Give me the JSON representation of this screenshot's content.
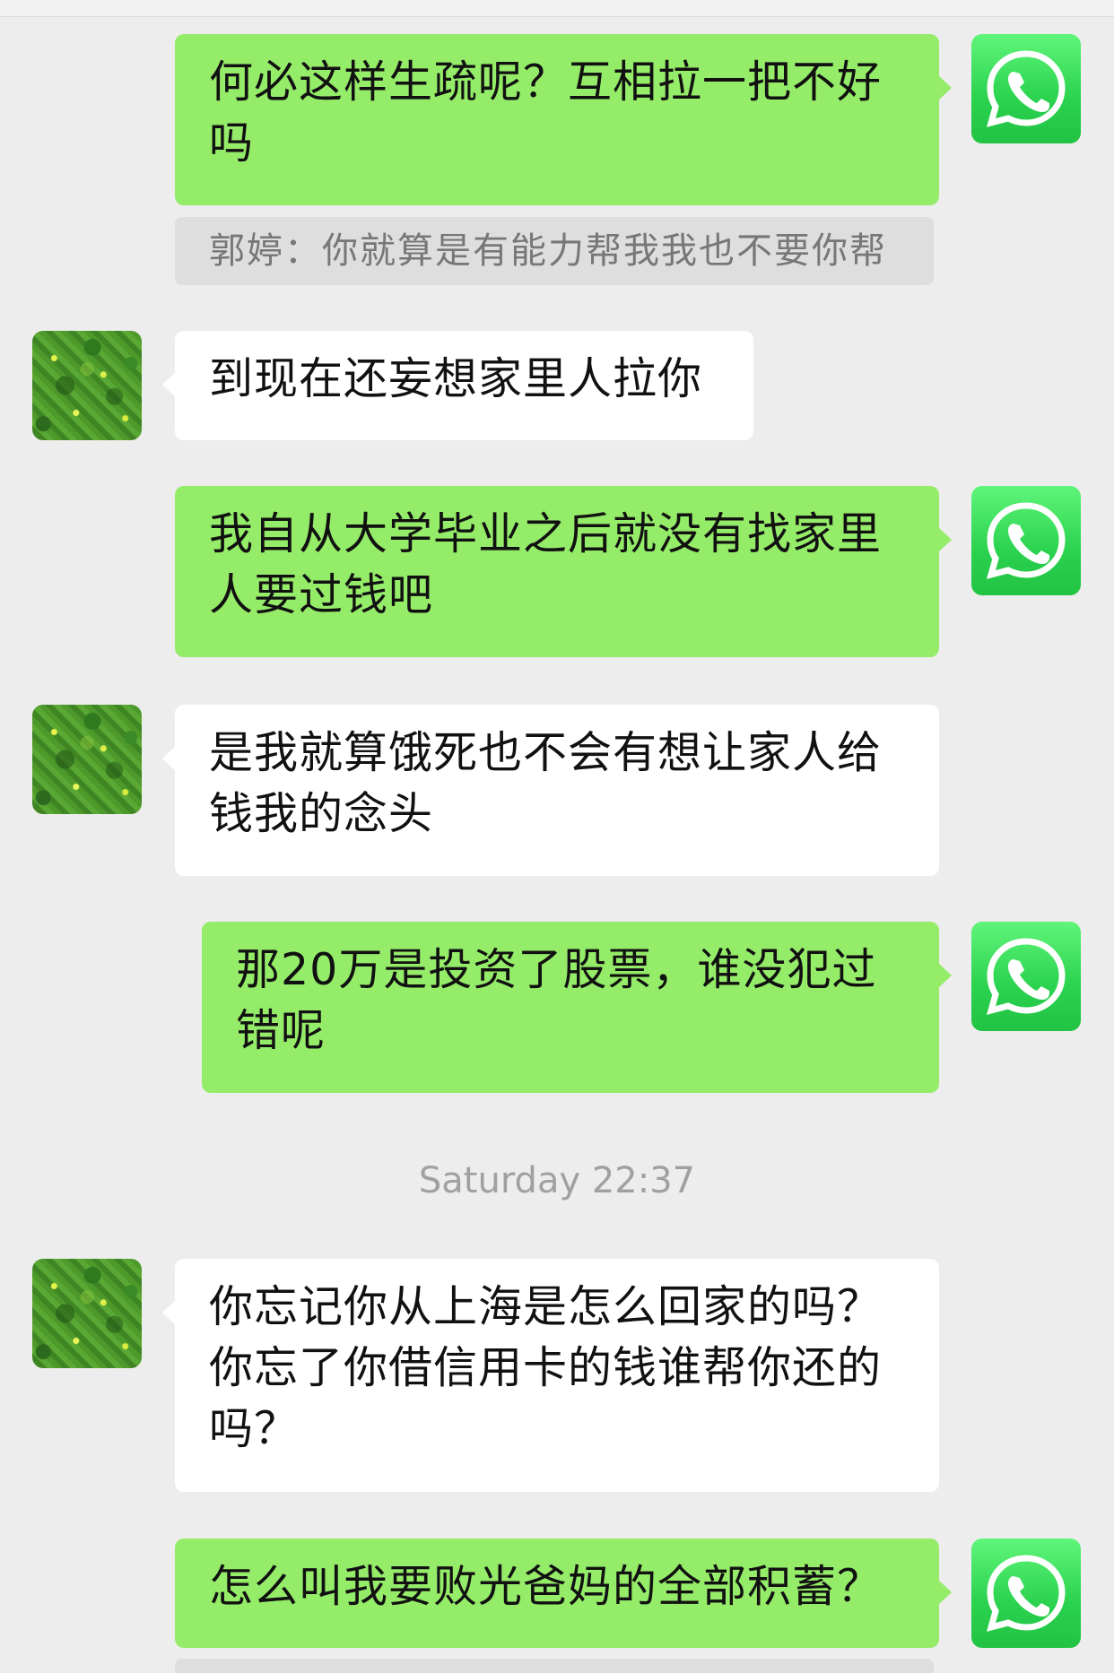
{
  "messages": [
    {
      "side": "me",
      "text": "何必这样生疏呢？互相拉一把不好吗",
      "quote": "郭婷：你就算是有能力帮我我也不要你帮"
    },
    {
      "side": "other",
      "text": "到现在还妄想家里人拉你"
    },
    {
      "side": "me",
      "text": "我自从大学毕业之后就没有找家里人要过钱吧"
    },
    {
      "side": "other",
      "text": "是我就算饿死也不会有想让家人给钱我的念头"
    },
    {
      "side": "me",
      "text": "那20万是投资了股票，谁没犯过错呢"
    },
    {
      "side": "other",
      "text": "你忘记你从上海是怎么回家的吗？你忘了你借信用卡的钱谁帮你还的吗？"
    },
    {
      "side": "me",
      "text": "怎么叫我要败光爸妈的全部积蓄？"
    }
  ],
  "timestamp": "Saturday 22:37",
  "avatars": {
    "me": "whatsapp-logo-icon",
    "other": "green-foliage-photo"
  },
  "colors": {
    "background": "#ededed",
    "my_bubble": "#95ec69",
    "other_bubble": "#ffffff",
    "quote_bg": "#dedede",
    "whatsapp_green": "#25d366"
  }
}
